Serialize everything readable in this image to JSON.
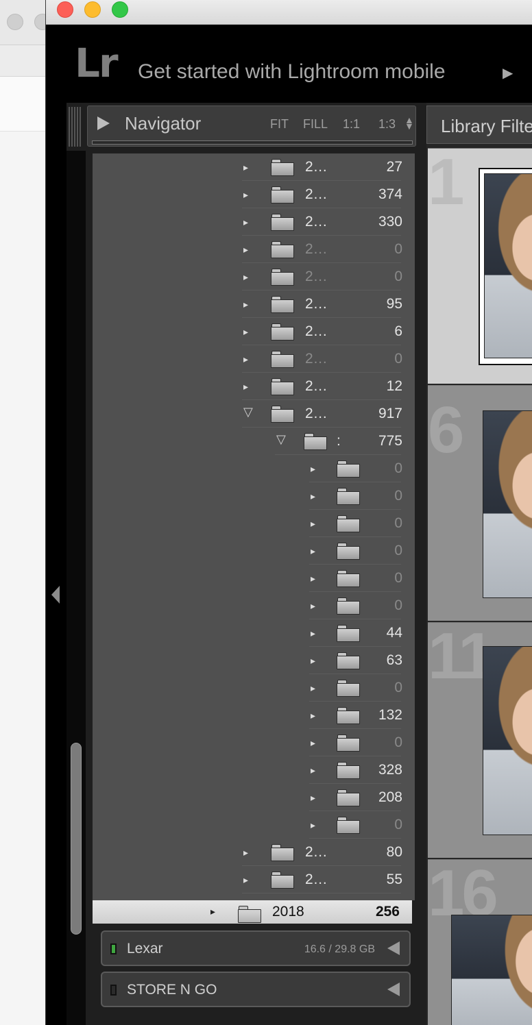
{
  "window_controls": {
    "close": "close",
    "minimize": "minimize",
    "maximize": "maximize"
  },
  "identity_plate": {
    "logo": "Lr",
    "mobile_text": "Get started with Lightroom mobile",
    "arrow": "▶"
  },
  "navigator": {
    "title": "Navigator",
    "zoom_options": [
      "FIT",
      "FILL",
      "1:1",
      "1:3"
    ],
    "zoom_toggle": "⬍"
  },
  "library_filter": {
    "label": "Library Filter"
  },
  "folders": [
    {
      "name": "2…",
      "count": "27",
      "dim": false,
      "level": 0
    },
    {
      "name": "2…",
      "count": "374",
      "dim": false,
      "level": 0
    },
    {
      "name": "2…",
      "count": "330",
      "dim": false,
      "level": 0
    },
    {
      "name": "2…",
      "count": "0",
      "dim": true,
      "level": 0
    },
    {
      "name": "2…",
      "count": "0",
      "dim": true,
      "level": 0
    },
    {
      "name": "2…",
      "count": "95",
      "dim": false,
      "level": 0
    },
    {
      "name": "2…",
      "count": "6",
      "dim": false,
      "level": 0
    },
    {
      "name": "2…",
      "count": "0",
      "dim": true,
      "level": 0
    },
    {
      "name": "2…",
      "count": "12",
      "dim": false,
      "level": 0
    },
    {
      "name": "2…",
      "count": "917",
      "dim": false,
      "level": 0,
      "expanded": true
    },
    {
      "name": ":",
      "count": "775",
      "dim": false,
      "level": 1,
      "expanded": true
    },
    {
      "name": "",
      "count": "0",
      "dim": true,
      "level": 2
    },
    {
      "name": "",
      "count": "0",
      "dim": true,
      "level": 2
    },
    {
      "name": "",
      "count": "0",
      "dim": true,
      "level": 2
    },
    {
      "name": "",
      "count": "0",
      "dim": true,
      "level": 2
    },
    {
      "name": "",
      "count": "0",
      "dim": true,
      "level": 2
    },
    {
      "name": "",
      "count": "0",
      "dim": true,
      "level": 2
    },
    {
      "name": "",
      "count": "44",
      "dim": false,
      "level": 2
    },
    {
      "name": "",
      "count": "63",
      "dim": false,
      "level": 2
    },
    {
      "name": "",
      "count": "0",
      "dim": true,
      "level": 2
    },
    {
      "name": "",
      "count": "132",
      "dim": false,
      "level": 2
    },
    {
      "name": "",
      "count": "0",
      "dim": true,
      "level": 2
    },
    {
      "name": "",
      "count": "328",
      "dim": false,
      "level": 2
    },
    {
      "name": "",
      "count": "208",
      "dim": false,
      "level": 2
    },
    {
      "name": "",
      "count": "0",
      "dim": true,
      "level": 2
    },
    {
      "name": "2…",
      "count": "80",
      "dim": false,
      "level": 0
    },
    {
      "name": "2…",
      "count": "55",
      "dim": false,
      "level": 0
    }
  ],
  "selected_folder": {
    "name": "2018",
    "count": "256"
  },
  "volumes": [
    {
      "name": "Lexar",
      "size": "16.6 / 29.8 GB",
      "indicator_color": "#3fa640"
    },
    {
      "name": "STORE N GO",
      "size": "",
      "indicator_color": "#2b2b2b"
    }
  ],
  "grid": [
    {
      "index": "1",
      "selected": true
    },
    {
      "index": "6",
      "selected": false
    },
    {
      "index": "11",
      "selected": false
    },
    {
      "index": "16",
      "selected": false
    }
  ],
  "icons": {
    "collapsed": "▸",
    "expanded": "▽",
    "panel_left": "◀"
  }
}
